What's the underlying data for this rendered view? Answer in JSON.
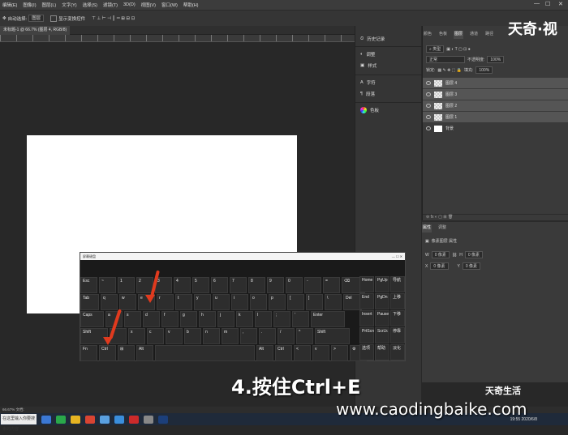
{
  "menu": {
    "items": [
      "编辑(E)",
      "图像(I)",
      "图层(L)",
      "文字(Y)",
      "选择(S)",
      "滤镜(T)",
      "3D(D)",
      "视图(V)",
      "窗口(W)",
      "帮助(H)"
    ]
  },
  "options": {
    "tool": "自动选择:",
    "select_value": "图层",
    "transform": "显示变换控件"
  },
  "doc_tab": "未标题-1 @ 66.7% (图层 4, RGB/8)",
  "mid_panel": {
    "items": [
      {
        "label": "历史记录",
        "icon": "history-icon"
      },
      {
        "label": "调整",
        "icon": "adjust-icon"
      },
      {
        "label": "样式",
        "icon": "style-icon"
      },
      {
        "label": "字符",
        "icon": "character-icon"
      },
      {
        "label": "段落",
        "icon": "paragraph-icon"
      },
      {
        "label": "色板",
        "icon": "swatch-icon"
      }
    ]
  },
  "right_panel": {
    "tabs": [
      "颜色",
      "色板",
      "图层",
      "通道",
      "路径"
    ],
    "active_tab": "图层",
    "filter_label": "类型",
    "blend_mode": "正常",
    "opacity_label": "不透明度:",
    "opacity_value": "100%",
    "lock_label": "锁定:",
    "fill_label": "填充:",
    "fill_value": "100%",
    "layers": [
      {
        "name": "图层 4",
        "selected": true
      },
      {
        "name": "图层 3",
        "selected": true
      },
      {
        "name": "图层 2",
        "selected": true
      },
      {
        "name": "图层 1",
        "selected": true
      },
      {
        "name": "背景",
        "selected": false
      }
    ]
  },
  "properties": {
    "tabs": [
      "属性",
      "调整"
    ],
    "title": "像素图层 属性",
    "w_label": "W",
    "w_value": "0 像素",
    "h_label": "H",
    "h_value": "0 像素",
    "x_label": "X",
    "x_value": "0 像素",
    "y_label": "Y",
    "y_value": "0 像素"
  },
  "status": "66.67%   文档:",
  "taskbar": {
    "search": "在这里输入你要搜索的内容",
    "time": "19:55",
    "date": "2020/6/8"
  },
  "osk": {
    "title": "屏幕键盘",
    "rows": [
      [
        "Esc",
        "~",
        "1",
        "2",
        "3",
        "4",
        "5",
        "6",
        "7",
        "8",
        "9",
        "0",
        "-",
        "=",
        "⌫"
      ],
      [
        "Tab",
        "q",
        "w",
        "e",
        "r",
        "t",
        "y",
        "u",
        "i",
        "o",
        "p",
        "[",
        "]",
        "\\",
        "Del"
      ],
      [
        "Caps",
        "a",
        "s",
        "d",
        "f",
        "g",
        "h",
        "j",
        "k",
        "l",
        ";",
        "'",
        "Enter"
      ],
      [
        "Shift",
        "z",
        "x",
        "c",
        "v",
        "b",
        "n",
        "m",
        ",",
        ".",
        "/",
        "^",
        "Shift"
      ],
      [
        "Fn",
        "Ctrl",
        "⊞",
        "Alt",
        "",
        "Alt",
        "Ctrl",
        "<",
        "v",
        ">",
        "⚙"
      ]
    ],
    "nav": [
      "Home",
      "PgUp",
      "导航",
      "End",
      "PgDn",
      "上移",
      "Insert",
      "Pause",
      "下移",
      "PrtScn",
      "ScrLk",
      "停靠",
      "选项",
      "帮助",
      "淡化"
    ]
  },
  "overlay": {
    "logo": "天奇·视",
    "caption": "4.按住Ctrl+E",
    "brand": "天奇生活",
    "url": "www.caodingbaike.com"
  },
  "colors": {
    "accent_arrow": "#e03a1e",
    "canvas": "#ffffff",
    "panel": "#3a3a3a"
  }
}
